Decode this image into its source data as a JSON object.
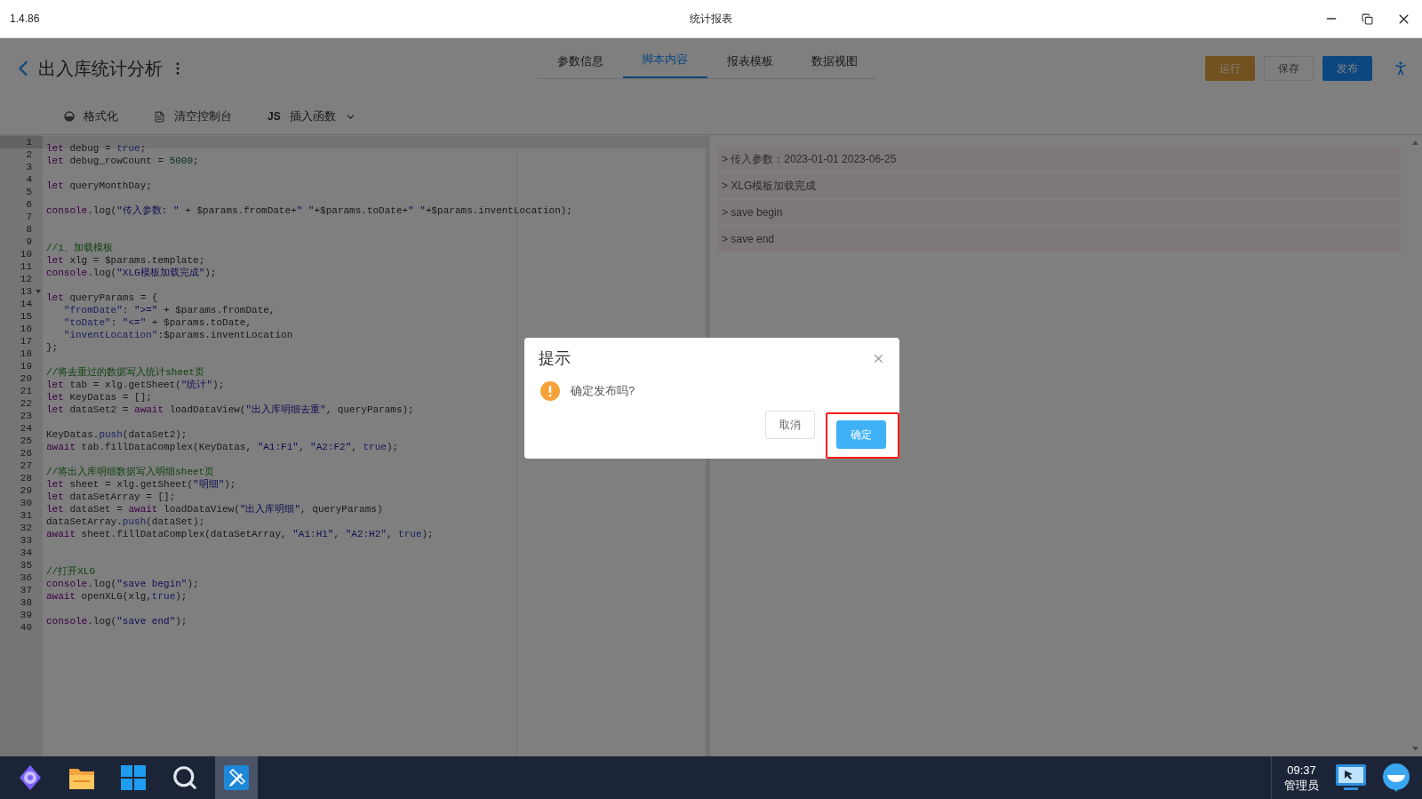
{
  "window": {
    "version": "1.4.86",
    "title": "统计报表"
  },
  "header": {
    "back_title": "出入库统计分析",
    "tabs": [
      {
        "label": "参数信息",
        "selected": false
      },
      {
        "label": "脚本内容",
        "selected": true
      },
      {
        "label": "报表模板",
        "selected": false
      },
      {
        "label": "数据视图",
        "selected": false
      }
    ],
    "buttons": [
      {
        "label": "运行",
        "kind": "warning"
      },
      {
        "label": "保存",
        "kind": "plain"
      },
      {
        "label": "发布",
        "kind": "primary"
      }
    ]
  },
  "toolbar": [
    {
      "label": "格式化",
      "kind": "format"
    },
    {
      "label": "清空控制台",
      "kind": "clear"
    },
    {
      "label": "插入函数",
      "kind": "insert",
      "prefix": "JS"
    }
  ],
  "editor": {
    "lines": [
      {
        "n": "1",
        "active": true,
        "tokens": [
          {
            "kind": "kw",
            "text": "let"
          },
          {
            "kind": "plain",
            "text": " debug = "
          },
          {
            "kind": "atom",
            "text": "true"
          },
          {
            "kind": "plain",
            "text": ";"
          }
        ]
      },
      {
        "n": "2",
        "active": false,
        "tokens": [
          {
            "kind": "kw",
            "text": "let"
          },
          {
            "kind": "plain",
            "text": " debug_rowCount = "
          },
          {
            "kind": "num",
            "text": "5000"
          },
          {
            "kind": "plain",
            "text": ";"
          }
        ]
      },
      {
        "n": "3",
        "active": false
      },
      {
        "n": "4",
        "active": false,
        "tokens": [
          {
            "kind": "kw",
            "text": "let"
          },
          {
            "kind": "plain",
            "text": " queryMonthDay;"
          }
        ]
      },
      {
        "n": "5",
        "active": false
      },
      {
        "n": "6",
        "active": false,
        "tokens": [
          {
            "kind": "kw",
            "text": "console"
          },
          {
            "kind": "plain",
            "text": ".log("
          },
          {
            "kind": "str",
            "text": "\"传入参数: \""
          },
          {
            "kind": "plain",
            "text": " + $params.fromDate+"
          },
          {
            "kind": "str",
            "text": "\" \""
          },
          {
            "kind": "plain",
            "text": "+$params.toDate+"
          },
          {
            "kind": "str",
            "text": "\" \""
          },
          {
            "kind": "plain",
            "text": "+$params.inventLocation);"
          }
        ]
      },
      {
        "n": "7",
        "active": false
      },
      {
        "n": "8",
        "active": false
      },
      {
        "n": "9",
        "active": false,
        "tokens": [
          {
            "kind": "com",
            "text": "//1、加载模板"
          }
        ]
      },
      {
        "n": "10",
        "active": false,
        "tokens": [
          {
            "kind": "kw",
            "text": "let"
          },
          {
            "kind": "plain",
            "text": " xlg = $params.template;"
          }
        ]
      },
      {
        "n": "11",
        "active": false,
        "tokens": [
          {
            "kind": "kw",
            "text": "console"
          },
          {
            "kind": "plain",
            "text": ".log("
          },
          {
            "kind": "str",
            "text": "\"XLG模板加载完成\""
          },
          {
            "kind": "plain",
            "text": ");"
          }
        ]
      },
      {
        "n": "12",
        "active": false
      },
      {
        "n": "13",
        "active": false,
        "foldable": true,
        "tokens": [
          {
            "kind": "kw",
            "text": "let"
          },
          {
            "kind": "plain",
            "text": " queryParams = {"
          }
        ]
      },
      {
        "n": "14",
        "active": false,
        "tokens": [
          {
            "kind": "atom",
            "text": "   \"fromDate\""
          },
          {
            "kind": "plain",
            "text": ": "
          },
          {
            "kind": "str",
            "text": "\">=\""
          },
          {
            "kind": "plain",
            "text": " + $params.fromDate,"
          }
        ]
      },
      {
        "n": "15",
        "active": false,
        "tokens": [
          {
            "kind": "atom",
            "text": "   \"toDate\""
          },
          {
            "kind": "plain",
            "text": ": "
          },
          {
            "kind": "str",
            "text": "\"<=\""
          },
          {
            "kind": "plain",
            "text": " + $params.toDate,"
          }
        ]
      },
      {
        "n": "16",
        "active": false,
        "tokens": [
          {
            "kind": "atom",
            "text": "   \"inventLocation\""
          },
          {
            "kind": "plain",
            "text": ":$params.inventLocation"
          }
        ]
      },
      {
        "n": "17",
        "active": false,
        "tokens": [
          {
            "kind": "plain",
            "text": "};"
          }
        ]
      },
      {
        "n": "18",
        "active": false
      },
      {
        "n": "19",
        "active": false,
        "tokens": [
          {
            "kind": "com",
            "text": "//将去重过的数据写入统计sheet页"
          }
        ]
      },
      {
        "n": "20",
        "active": false,
        "tokens": [
          {
            "kind": "kw",
            "text": "let"
          },
          {
            "kind": "plain",
            "text": " tab = xlg.getSheet("
          },
          {
            "kind": "str",
            "text": "\"统计\""
          },
          {
            "kind": "plain",
            "text": ");"
          }
        ]
      },
      {
        "n": "21",
        "active": false,
        "tokens": [
          {
            "kind": "kw",
            "text": "let"
          },
          {
            "kind": "plain",
            "text": " KeyDatas = [];"
          }
        ]
      },
      {
        "n": "22",
        "active": false,
        "tokens": [
          {
            "kind": "kw",
            "text": "let"
          },
          {
            "kind": "plain",
            "text": " dataSet2 = "
          },
          {
            "kind": "kw",
            "text": "await"
          },
          {
            "kind": "plain",
            "text": " loadDataView("
          },
          {
            "kind": "str",
            "text": "\"出入库明细去重\""
          },
          {
            "kind": "plain",
            "text": ", queryParams);"
          }
        ]
      },
      {
        "n": "23",
        "active": false
      },
      {
        "n": "24",
        "active": false,
        "tokens": [
          {
            "kind": "plain",
            "text": "KeyDatas."
          },
          {
            "kind": "atom",
            "text": "push"
          },
          {
            "kind": "plain",
            "text": "(dataSet2);"
          }
        ]
      },
      {
        "n": "25",
        "active": false,
        "tokens": [
          {
            "kind": "kw",
            "text": "await"
          },
          {
            "kind": "plain",
            "text": " tab.fillDataComplex(KeyDatas, "
          },
          {
            "kind": "str",
            "text": "\"A1:F1\""
          },
          {
            "kind": "plain",
            "text": ", "
          },
          {
            "kind": "str",
            "text": "\"A2:F2\""
          },
          {
            "kind": "plain",
            "text": ", "
          },
          {
            "kind": "atom",
            "text": "true"
          },
          {
            "kind": "plain",
            "text": ");"
          }
        ]
      },
      {
        "n": "26",
        "active": false
      },
      {
        "n": "27",
        "active": false,
        "tokens": [
          {
            "kind": "com",
            "text": "//将出入库明细数据写入明细sheet页"
          }
        ]
      },
      {
        "n": "28",
        "active": false,
        "tokens": [
          {
            "kind": "kw",
            "text": "let"
          },
          {
            "kind": "plain",
            "text": " sheet = xlg.getSheet("
          },
          {
            "kind": "str",
            "text": "\"明细\""
          },
          {
            "kind": "plain",
            "text": ");"
          }
        ]
      },
      {
        "n": "29",
        "active": false,
        "tokens": [
          {
            "kind": "kw",
            "text": "let"
          },
          {
            "kind": "plain",
            "text": " dataSetArray = [];"
          }
        ]
      },
      {
        "n": "30",
        "active": false,
        "tokens": [
          {
            "kind": "kw",
            "text": "let"
          },
          {
            "kind": "plain",
            "text": " dataSet = "
          },
          {
            "kind": "kw",
            "text": "await"
          },
          {
            "kind": "plain",
            "text": " loadDataView("
          },
          {
            "kind": "str",
            "text": "\"出入库明细\""
          },
          {
            "kind": "plain",
            "text": ", queryParams)"
          }
        ]
      },
      {
        "n": "31",
        "active": false,
        "tokens": [
          {
            "kind": "plain",
            "text": "dataSetArray."
          },
          {
            "kind": "atom",
            "text": "push"
          },
          {
            "kind": "plain",
            "text": "(dataSet);"
          }
        ]
      },
      {
        "n": "32",
        "active": false,
        "tokens": [
          {
            "kind": "kw",
            "text": "await"
          },
          {
            "kind": "plain",
            "text": " sheet.fillDataComplex(dataSetArray, "
          },
          {
            "kind": "str",
            "text": "\"A1:H1\""
          },
          {
            "kind": "plain",
            "text": ", "
          },
          {
            "kind": "str",
            "text": "\"A2:H2\""
          },
          {
            "kind": "plain",
            "text": ", "
          },
          {
            "kind": "atom",
            "text": "true"
          },
          {
            "kind": "plain",
            "text": ");"
          }
        ]
      },
      {
        "n": "33",
        "active": false
      },
      {
        "n": "34",
        "active": false
      },
      {
        "n": "35",
        "active": false,
        "tokens": [
          {
            "kind": "com",
            "text": "//打开XLG"
          }
        ]
      },
      {
        "n": "36",
        "active": false,
        "tokens": [
          {
            "kind": "kw",
            "text": "console"
          },
          {
            "kind": "plain",
            "text": ".log("
          },
          {
            "kind": "str",
            "text": "\"save begin\""
          },
          {
            "kind": "plain",
            "text": ");"
          }
        ]
      },
      {
        "n": "37",
        "active": false,
        "tokens": [
          {
            "kind": "kw",
            "text": "await"
          },
          {
            "kind": "plain",
            "text": " openXLG(xlg,"
          },
          {
            "kind": "atom",
            "text": "true"
          },
          {
            "kind": "plain",
            "text": ");"
          }
        ]
      },
      {
        "n": "38",
        "active": false
      },
      {
        "n": "39",
        "active": false,
        "tokens": [
          {
            "kind": "kw",
            "text": "console"
          },
          {
            "kind": "plain",
            "text": ".log("
          },
          {
            "kind": "str",
            "text": "\"save end\""
          },
          {
            "kind": "plain",
            "text": ");"
          }
        ]
      },
      {
        "n": "40",
        "active": false
      }
    ]
  },
  "console": [
    "> 传入参数：2023-01-01 2023-06-25",
    "> XLG模板加载完成",
    "> save begin",
    "> save end"
  ],
  "dialog": {
    "title": "提示",
    "message": "确定发布吗?",
    "buttons": [
      {
        "label": "取消",
        "kind": "plain",
        "highlighted": false
      },
      {
        "label": "确定",
        "kind": "primary",
        "highlighted": true
      }
    ]
  },
  "taskbar": {
    "apps": [
      {
        "kind": "launcher",
        "selected": false
      },
      {
        "kind": "folder",
        "selected": false
      },
      {
        "kind": "windows",
        "selected": false
      },
      {
        "kind": "search",
        "selected": false
      },
      {
        "kind": "editor",
        "selected": true
      }
    ],
    "time": "09:37",
    "user": "管理员"
  }
}
